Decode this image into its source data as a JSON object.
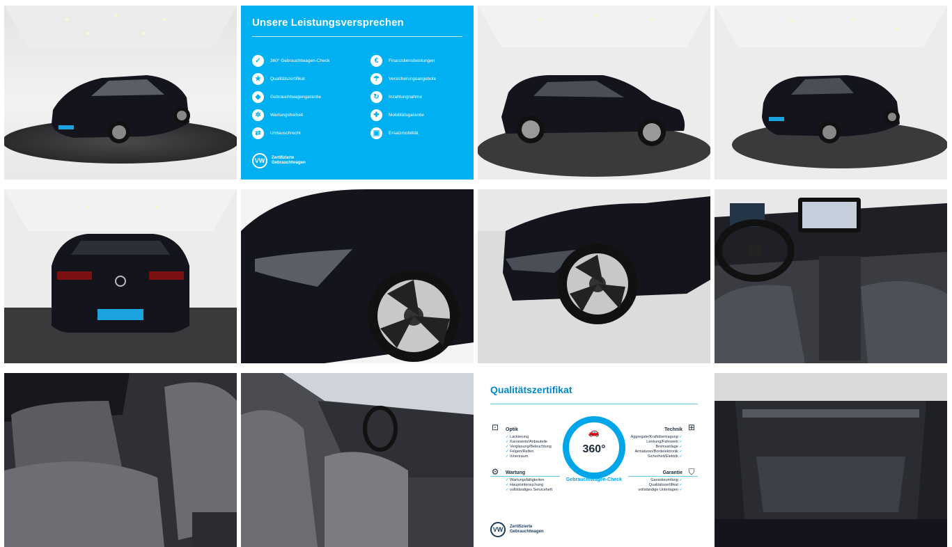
{
  "tiles": [
    {
      "name": "photo-front-left-showroom",
      "type": "photo"
    },
    {
      "name": "info-leistungsversprechen",
      "type": "info"
    },
    {
      "name": "photo-side-left-showroom",
      "type": "photo"
    },
    {
      "name": "photo-rear-right-showroom",
      "type": "photo"
    },
    {
      "name": "photo-rear-showroom",
      "type": "photo"
    },
    {
      "name": "photo-headlight-wheel-closeup",
      "type": "photo"
    },
    {
      "name": "photo-front-wheel",
      "type": "photo"
    },
    {
      "name": "photo-dashboard-interior",
      "type": "photo"
    },
    {
      "name": "photo-rear-seats",
      "type": "photo"
    },
    {
      "name": "photo-front-seats-side",
      "type": "photo"
    },
    {
      "name": "info-qualitaetszertifikat",
      "type": "info"
    },
    {
      "name": "photo-trunk",
      "type": "photo"
    }
  ],
  "promise": {
    "title": "Unsere Leistungsversprechen",
    "left": [
      {
        "icon": "check-circle-icon",
        "label": "360° Gebrauchtwagen-Check"
      },
      {
        "icon": "certificate-icon",
        "label": "Qualitätszertifikat"
      },
      {
        "icon": "shield-icon",
        "label": "Gebrauchtwagengarantie"
      },
      {
        "icon": "wrench-icon",
        "label": "Wartungsfreiheit"
      },
      {
        "icon": "exchange-icon",
        "label": "Umtauschrecht"
      }
    ],
    "right": [
      {
        "icon": "euro-icon",
        "label": "Finanzdienstleistungen"
      },
      {
        "icon": "umbrella-icon",
        "label": "Versicherungsangebote"
      },
      {
        "icon": "trade-in-icon",
        "label": "Inzahlungnahme"
      },
      {
        "icon": "mobility-icon",
        "label": "Mobilitätsgarantie"
      },
      {
        "icon": "replacement-car-icon",
        "label": "Ersatzmobilität"
      }
    ],
    "logo_line1": "Zertifizierte",
    "logo_line2": "Gebrauchtwagen"
  },
  "certificate": {
    "title": "Qualitätszertifikat",
    "ring_text": "Gebrauchtwagen-Check",
    "big": "360°",
    "optik": {
      "title": "Optik",
      "items": [
        "Lackierung",
        "Karosserie/Anbauteile",
        "Verglasung/Beleuchtung",
        "Felgen/Reifen",
        "Innenraum"
      ]
    },
    "technik": {
      "title": "Technik",
      "items": [
        "Aggregate/Kraftübertragung",
        "Lenkung/Fahrwerk",
        "Bremsanlage",
        "Armaturen/Bordelektronik",
        "Sicherheit/Elektrik"
      ]
    },
    "wartung": {
      "title": "Wartung",
      "items": [
        "Wartungsfälligkeiten",
        "Hauptuntersuchung",
        "vollständiges Serviceheft"
      ]
    },
    "garantie": {
      "title": "Garantie",
      "items": [
        "Garantieumfang",
        "Qualitätszertifikat",
        "vollständige Unterlagen"
      ]
    },
    "logo_line1": "Zertifizierte",
    "logo_line2": "Gebrauchtwagen"
  },
  "colors": {
    "vw_blue": "#00b0f0",
    "car_black": "#14151c",
    "floor": "#3a3a3c"
  }
}
